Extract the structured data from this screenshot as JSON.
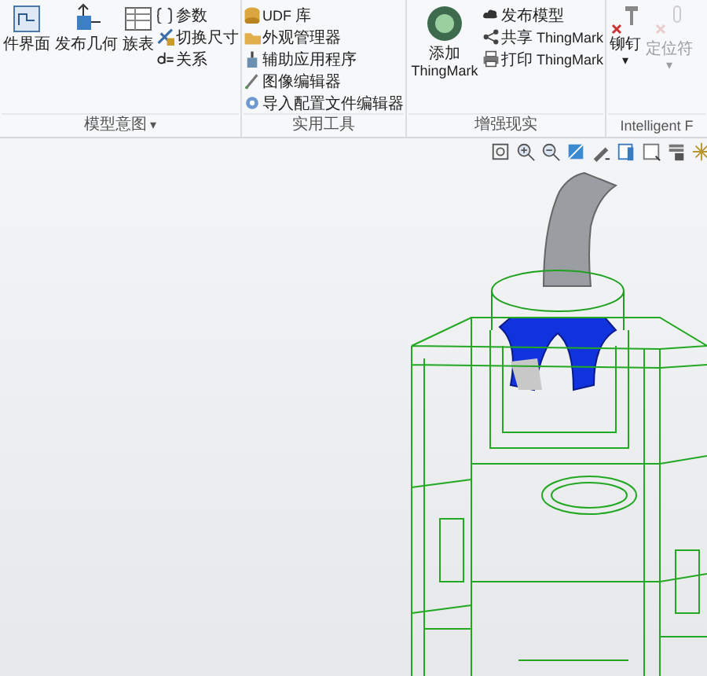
{
  "ribbon": {
    "groups": [
      {
        "label": "模型意图",
        "menu_glyph": "▾",
        "items": [
          {
            "kind": "large",
            "label": "件界面",
            "disabled": false
          },
          {
            "kind": "large",
            "label": "发布几何",
            "disabled": false
          },
          {
            "kind": "large",
            "label": "族表",
            "disabled": false
          },
          {
            "kind": "small",
            "label": "参数",
            "disabled": false
          },
          {
            "kind": "small",
            "label": "切换尺寸",
            "disabled": false
          },
          {
            "kind": "small",
            "label": "关系",
            "disabled": false
          }
        ]
      },
      {
        "label": "实用工具",
        "items": [
          {
            "kind": "small",
            "label": "UDF 库",
            "disabled": false
          },
          {
            "kind": "small",
            "label": "外观管理器",
            "disabled": false
          },
          {
            "kind": "small",
            "label": "辅助应用程序",
            "disabled": false
          },
          {
            "kind": "small",
            "label": "图像编辑器",
            "disabled": false
          },
          {
            "kind": "small",
            "label": "导入配置文件编辑器",
            "disabled": false
          }
        ]
      },
      {
        "label": "增强现实",
        "items": [
          {
            "kind": "large",
            "label": "添加 ThingMark",
            "disabled": false
          },
          {
            "kind": "small",
            "label": "发布模型",
            "disabled": false
          },
          {
            "kind": "small",
            "label": "共享 ThingMark",
            "disabled": false
          },
          {
            "kind": "small",
            "label": "打印 ThingMark",
            "disabled": false
          }
        ]
      },
      {
        "label": "Intelligent F",
        "items": [
          {
            "kind": "large",
            "label": "铆钉",
            "disabled": false,
            "caret": "▾"
          },
          {
            "kind": "large",
            "label": "定位符",
            "disabled": true,
            "caret": "▾"
          }
        ]
      }
    ]
  }
}
